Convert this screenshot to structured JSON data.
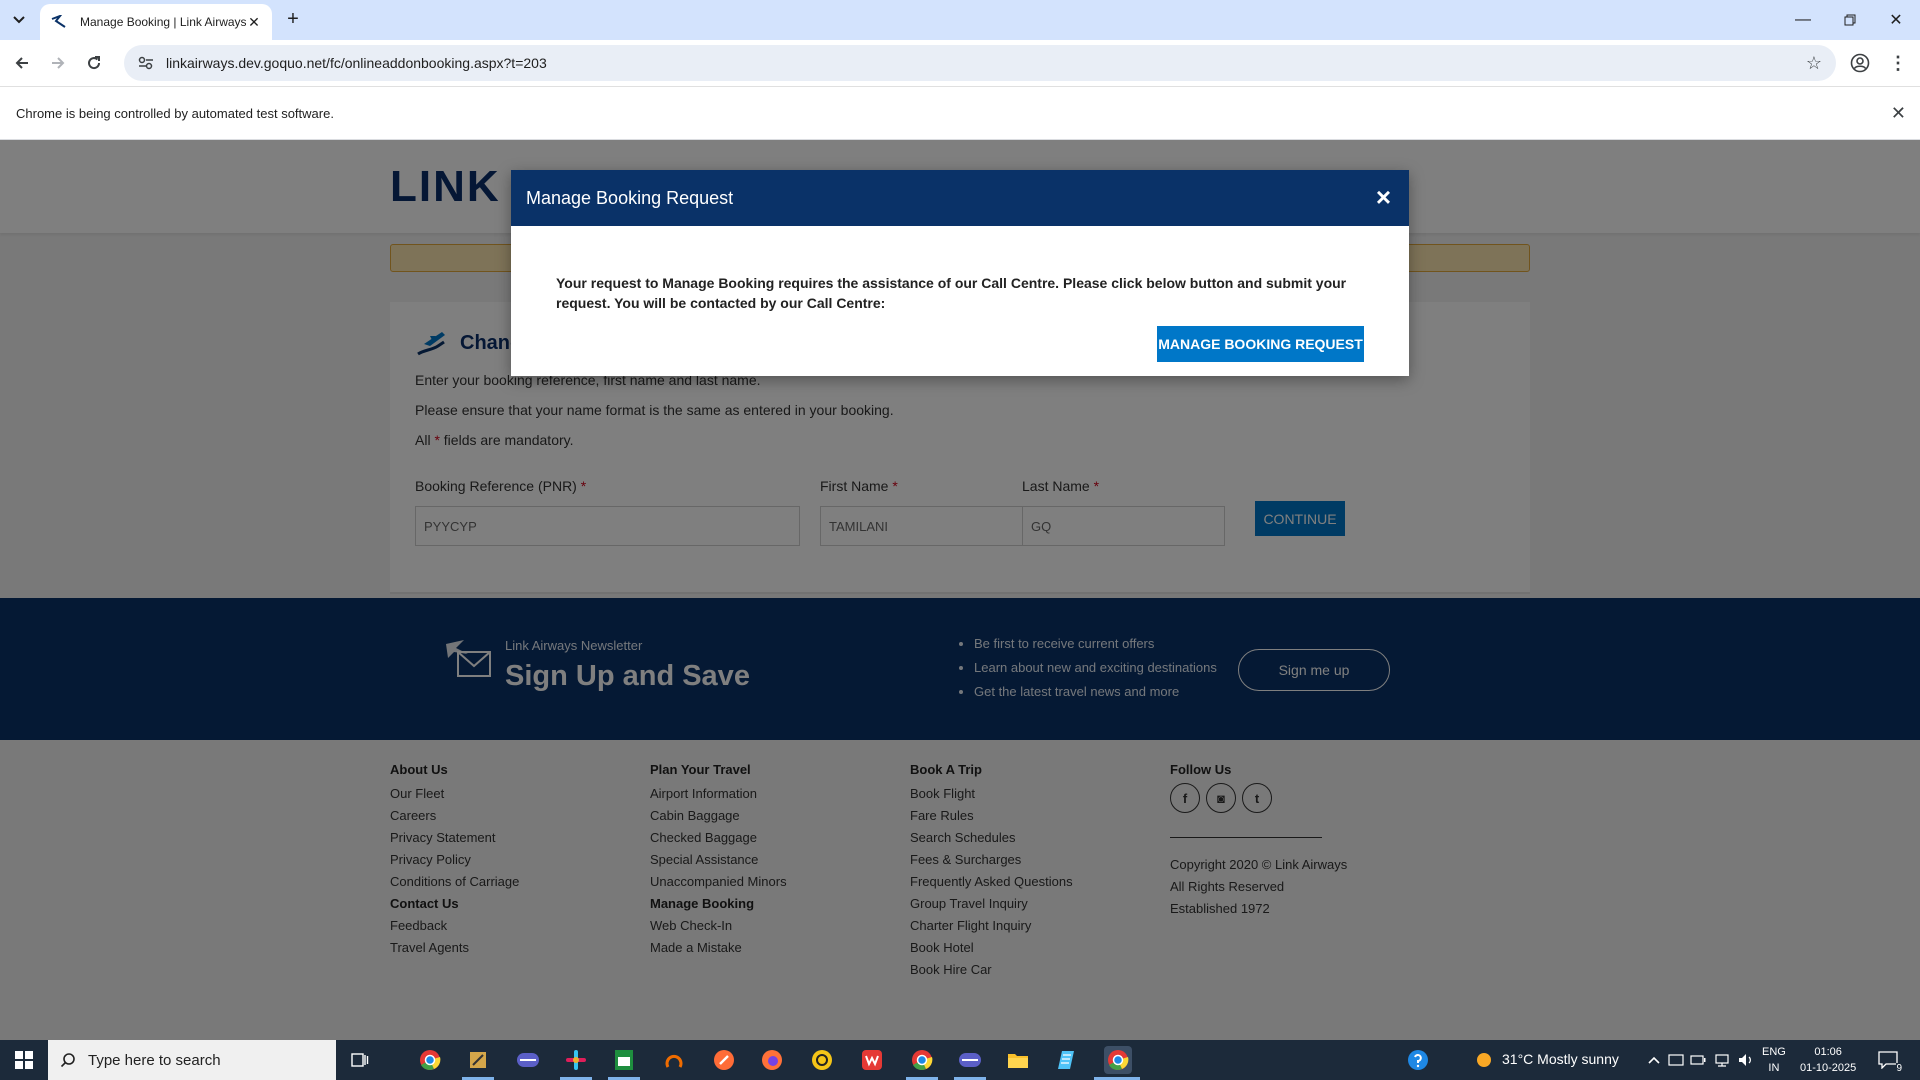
{
  "browser": {
    "tab_title": "Manage Booking | Link Airways",
    "url": "linkairways.dev.goquo.net/fc/onlineaddonbooking.aspx?t=203",
    "infobar_text": "Chrome is being controlled by automated test software."
  },
  "site": {
    "logo_text": "LINK a",
    "card_title": "Chang",
    "instructions": [
      "Enter your booking reference, first name and last name.",
      "Please ensure that your name format is the same as entered in your booking."
    ],
    "mandatory_prefix": "All",
    "mandatory_star": "*",
    "mandatory_suffix": "fields are mandatory.",
    "fields": {
      "pnr_label": "Booking Reference (PNR)",
      "pnr_value": "PYYCYP",
      "first_label": "First Name",
      "first_value": "TAMILANI",
      "last_label": "Last Name",
      "last_value": "GQ",
      "required_mark": "*"
    },
    "continue_label": "CONTINUE"
  },
  "newsletter": {
    "kicker": "Link Airways Newsletter",
    "title": "Sign Up and Save",
    "bullets": [
      "Be first to receive current offers",
      "Learn about new and exciting destinations",
      "Get the latest travel news and more"
    ],
    "signup_label": "Sign me up"
  },
  "footer": {
    "col1": {
      "heading": "About Us",
      "links": [
        "Our Fleet",
        "Careers",
        "Privacy Statement",
        "Privacy Policy",
        "Conditions of Carriage"
      ],
      "heading2": "Contact Us",
      "links2": [
        "Feedback",
        "Travel Agents"
      ]
    },
    "col2": {
      "heading": "Plan Your Travel",
      "links": [
        "Airport Information",
        "Cabin Baggage",
        "Checked Baggage",
        "Special Assistance",
        "Unaccompanied Minors"
      ],
      "heading2": "Manage Booking",
      "links2": [
        "Web Check-In",
        "Made a Mistake"
      ]
    },
    "col3": {
      "heading": "Book A Trip",
      "links": [
        "Book Flight",
        "Fare Rules",
        "Search Schedules",
        "Fees & Surcharges",
        "Frequently Asked Questions",
        "Group Travel Inquiry",
        "Charter Flight Inquiry",
        "Book Hotel",
        "Book Hire Car"
      ]
    },
    "col4": {
      "heading": "Follow Us",
      "social": [
        "f",
        "◙",
        "t"
      ],
      "copyright": [
        "Copyright 2020 © Link Airways",
        "All Rights Reserved",
        "Established 1972"
      ]
    }
  },
  "modal": {
    "title": "Manage Booking Request",
    "close_glyph": "×",
    "message": "Your request to Manage Booking requires the assistance of our Call Centre. Please click below button and submit your request. You will be contacted by our Call Centre:",
    "button_label": "MANAGE BOOKING REQUEST"
  },
  "taskbar": {
    "search_placeholder": "Type here to search",
    "weather": "31°C  Mostly sunny",
    "lang1": "ENG",
    "lang2": "IN",
    "time": "01:06",
    "date": "01-10-2025",
    "notif_count": "9"
  },
  "colors": {
    "brand_navy": "#0a3268",
    "button_blue": "#0077c8",
    "notice_bg": "#fde6b1"
  }
}
